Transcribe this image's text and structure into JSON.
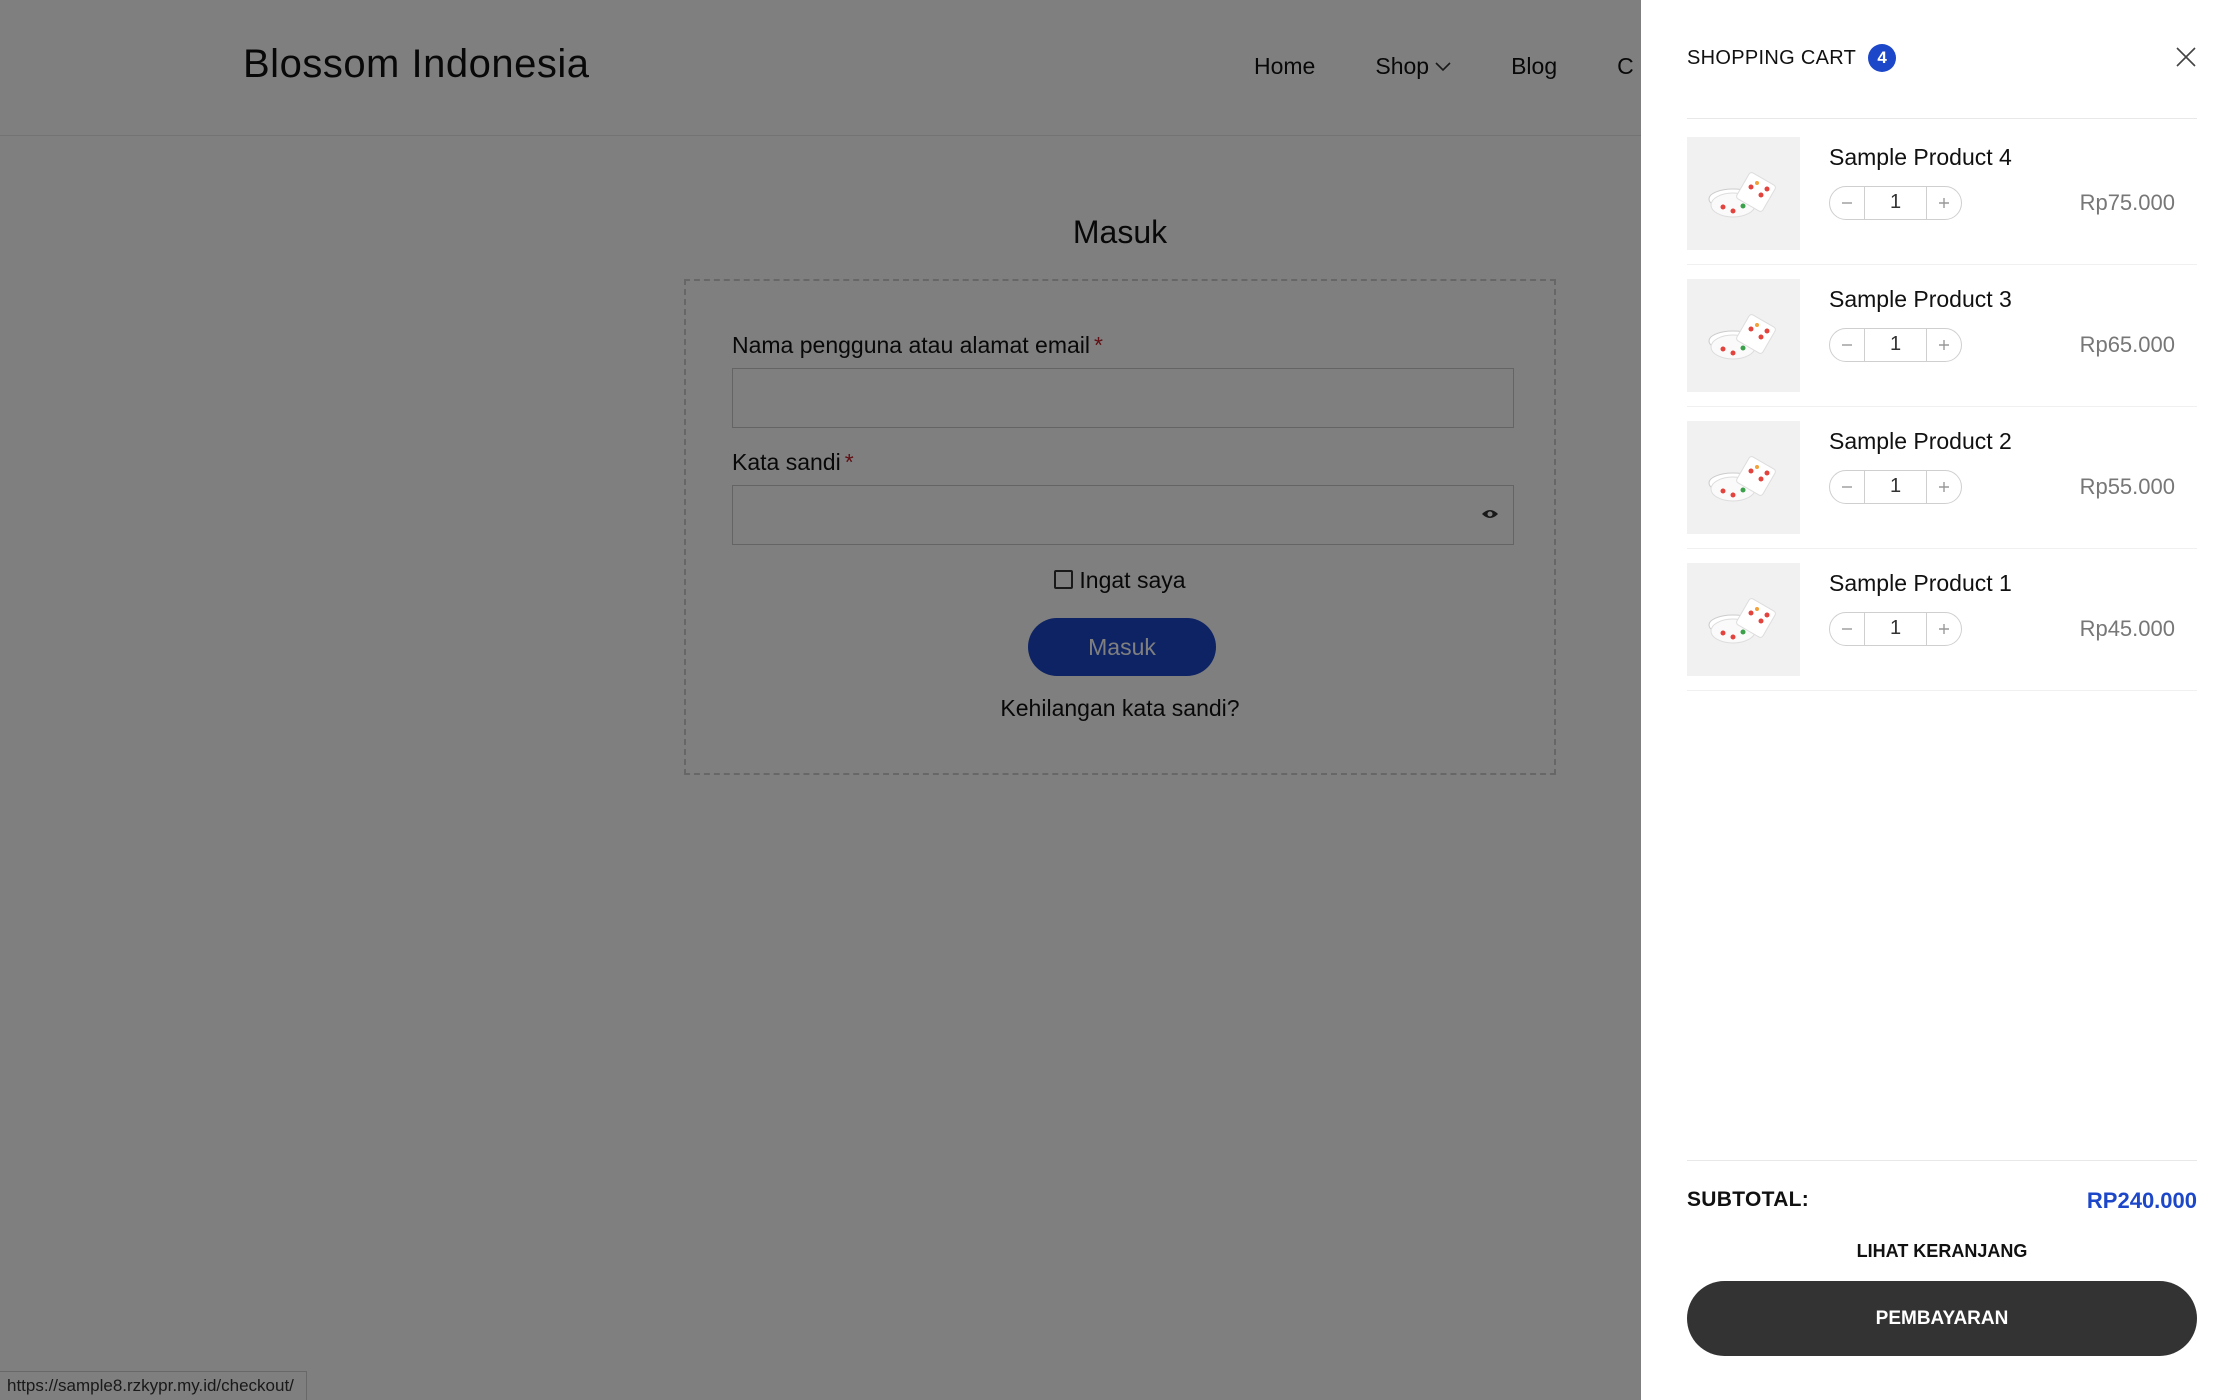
{
  "site": {
    "logo": "Blossom Indonesia"
  },
  "nav": {
    "home": "Home",
    "shop": "Shop",
    "blog": "Blog",
    "cutoff": "C"
  },
  "login": {
    "title": "Masuk",
    "username_label": "Nama pengguna atau alamat email",
    "password_label": "Kata sandi",
    "required_mark": "*",
    "remember_label": "Ingat saya",
    "submit_label": "Masuk",
    "lost_password": "Kehilangan kata sandi?"
  },
  "status_url": "https://sample8.rzkypr.my.id/checkout/",
  "cart": {
    "title": "SHOPPING CART",
    "count": "4",
    "items": [
      {
        "name": "Sample Product 4",
        "qty": "1",
        "price": "Rp75.000"
      },
      {
        "name": "Sample Product 3",
        "qty": "1",
        "price": "Rp65.000"
      },
      {
        "name": "Sample Product 2",
        "qty": "1",
        "price": "Rp55.000"
      },
      {
        "name": "Sample Product 1",
        "qty": "1",
        "price": "Rp45.000"
      }
    ],
    "subtotal_label": "SUBTOTAL:",
    "subtotal_value": "RP240.000",
    "view_cart": "LIHAT KERANJANG",
    "checkout": "PEMBAYARAN"
  },
  "colors": {
    "accent": "#1d47c9",
    "checkout_button": "#333333",
    "overlay": "rgba(0,0,0,0.5)"
  },
  "icons": [
    "chevron-down-icon",
    "eye-icon",
    "close-icon",
    "minus-icon",
    "plus-icon"
  ]
}
